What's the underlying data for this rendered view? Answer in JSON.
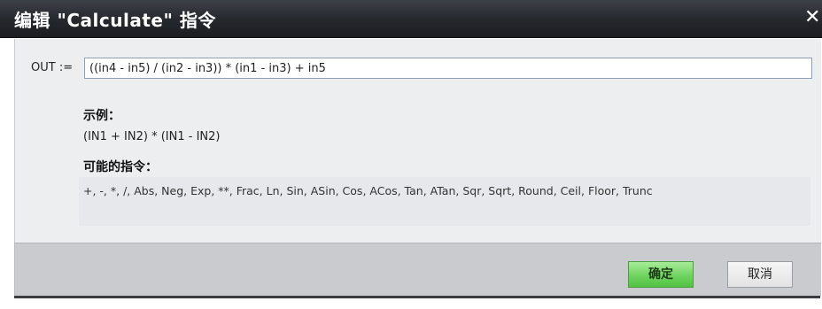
{
  "window": {
    "title": "编辑 \"Calculate\" 指令",
    "close_glyph": "✕"
  },
  "expression": {
    "label": "OUT :=",
    "value": "((in4 - in5) / (in2 - in3)) * (in1 - in3) + in5"
  },
  "example": {
    "heading": "示例：",
    "text": "(IN1 + IN2) * (IN1 - IN2)"
  },
  "instructions": {
    "heading": "可能的指令：",
    "text": "+, -, *, /, Abs, Neg, Exp, **, Frac, Ln, Sin, ASin, Cos, ACos, Tan, ATan, Sqr, Sqrt, Round, Ceil, Floor, Trunc"
  },
  "buttons": {
    "ok_label": "确定",
    "cancel_label": "取消"
  },
  "colors": {
    "titlebar": "#24272c",
    "ok_button": "#6fd35f",
    "panel": "#eceef0",
    "footer": "#c9cbce"
  },
  "icons": {
    "close": "close-icon"
  }
}
